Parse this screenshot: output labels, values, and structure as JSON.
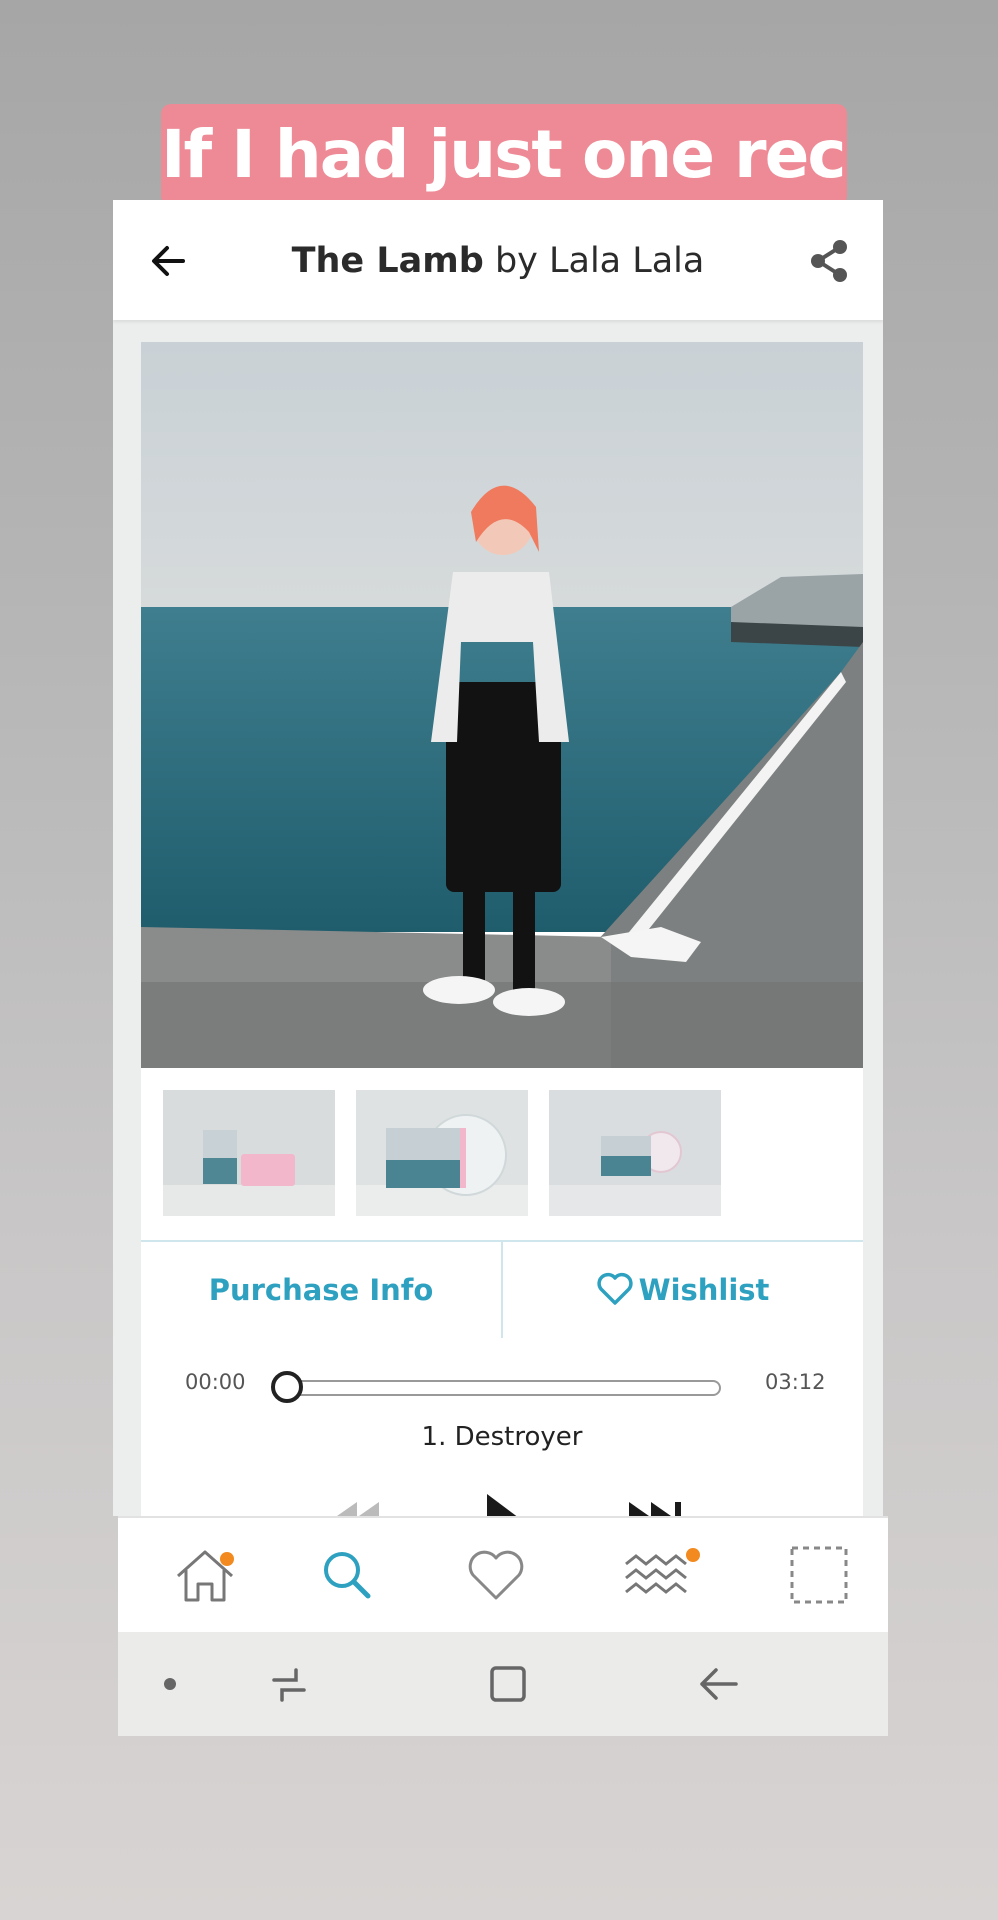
{
  "story": {
    "caption": "If I had just one rec..."
  },
  "appbar": {
    "title_album": "The Lamb",
    "title_by": " by Lala Lala",
    "back_icon": "arrow-left-icon",
    "share_icon": "share-icon"
  },
  "actions": {
    "purchase_label": "Purchase Info",
    "wishlist_label": "Wishlist",
    "accent": "#2ea1c0"
  },
  "player": {
    "elapsed": "00:00",
    "duration": "03:12",
    "progress": 0,
    "track": "1. Destroyer"
  },
  "bottom_nav": {
    "items": [
      "home-icon",
      "search-icon",
      "heart-icon",
      "feed-waves-icon",
      "collection-icon"
    ],
    "active": "search-icon",
    "badge_color": "#f28a1f"
  },
  "system_nav": {
    "items": [
      "dot-icon",
      "recents-icon",
      "home-square-icon",
      "back-icon"
    ]
  },
  "colors": {
    "caption_bg": "#ee8a95",
    "accent": "#2ea1c0"
  }
}
